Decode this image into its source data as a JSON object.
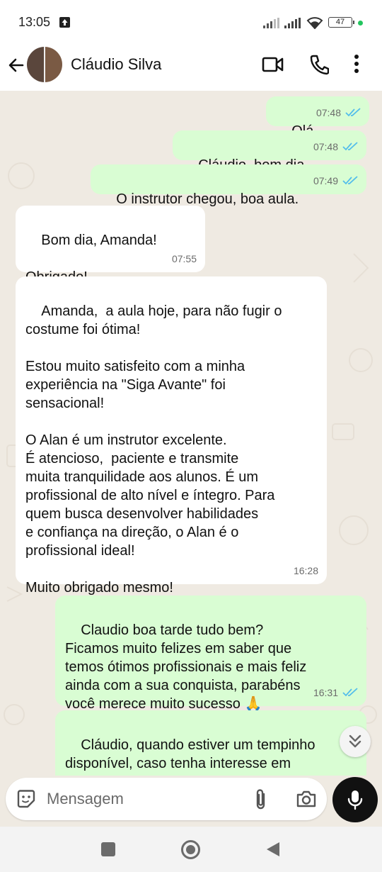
{
  "status_bar": {
    "time": "13:05",
    "battery": "47"
  },
  "header": {
    "contact_name": "Cláudio Silva"
  },
  "messages": [
    {
      "text": "Olá",
      "time": "07:48"
    },
    {
      "text": "Cláudio, bom dia",
      "time": "07:48"
    },
    {
      "text": "O instrutor chegou, boa aula.",
      "time": "07:49"
    },
    {
      "text": "Bom dia, Amanda!\n\nObrigado!",
      "time": "07:55"
    },
    {
      "text": "Amanda,  a aula hoje, para não fugir o\ncostume foi ótima!\n\nEstou muito satisfeito com a minha\nexperiência na \"Siga Avante\" foi\nsensacional!\n\nO Alan é um instrutor excelente.\nÉ atencioso,  paciente e transmite\nmuita tranquilidade aos alunos. É um\nprofissional de alto nível e íntegro. Para\nquem busca desenvolver habilidades\ne confiança na direção, o Alan é o\nprofissional ideal!\n\nMuito obrigado mesmo!",
      "time": "16:28"
    },
    {
      "text": "Claudio boa tarde tudo bem?\nFicamos muito felizes em saber que\ntemos ótimos profissionais e mais feliz\nainda com a sua conquista, parabéns\nvocê merece muito sucesso 🙏",
      "time": "16:31"
    },
    {
      "text": "Cláudio, quando estiver um tempinho\ndisponível, caso tenha interesse em\nfazer um vídeo em poucas palavras",
      "time": ""
    }
  ],
  "composer": {
    "placeholder": "Mensagem"
  },
  "icons": {
    "back": "arrow-left-icon",
    "video": "video-call-icon",
    "call": "phone-icon",
    "menu": "more-vert-icon",
    "sticker": "sticker-icon",
    "attach": "paperclip-icon",
    "camera": "camera-icon",
    "mic": "mic-icon",
    "scroll": "chevrons-down-icon",
    "read": "double-check-icon"
  },
  "colors": {
    "outgoing_bubble": "#d9fdd3",
    "incoming_bubble": "#ffffff",
    "chat_background": "#efeae2",
    "read_tick": "#53bdeb"
  }
}
